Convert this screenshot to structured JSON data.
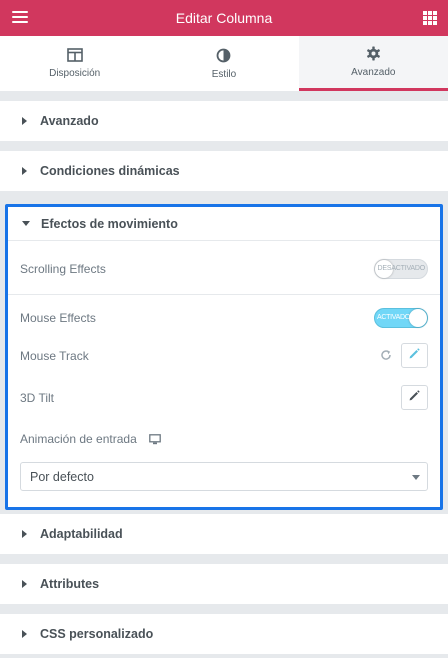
{
  "header": {
    "title": "Editar Columna",
    "menu_icon": "hamburger-icon",
    "grid_icon": "apps-grid-icon",
    "color": "#d1375e"
  },
  "tabs": [
    {
      "label": "Disposición",
      "icon": "layout-icon",
      "active": false
    },
    {
      "label": "Estilo",
      "icon": "contrast-icon",
      "active": false
    },
    {
      "label": "Avanzado",
      "icon": "gear-icon",
      "active": true
    }
  ],
  "sections": {
    "avanzado": "Avanzado",
    "condiciones": "Condiciones dinámicas",
    "efectos": "Efectos de movimiento",
    "adaptabilidad": "Adaptabilidad",
    "attributes": "Attributes",
    "css": "CSS personalizado"
  },
  "motion": {
    "scrolling_label": "Scrolling Effects",
    "scrolling_state": "DESACTIVADO",
    "mouse_label": "Mouse Effects",
    "mouse_state": "ACTIVADO",
    "mouse_track_label": "Mouse Track",
    "tilt_label": "3D Tilt",
    "entrance_label": "Animación de entrada",
    "entrance_value": "Por defecto"
  },
  "colors": {
    "accent": "#d1375e",
    "focus": "#1874e8",
    "toggle_on": "#71d7f7"
  }
}
